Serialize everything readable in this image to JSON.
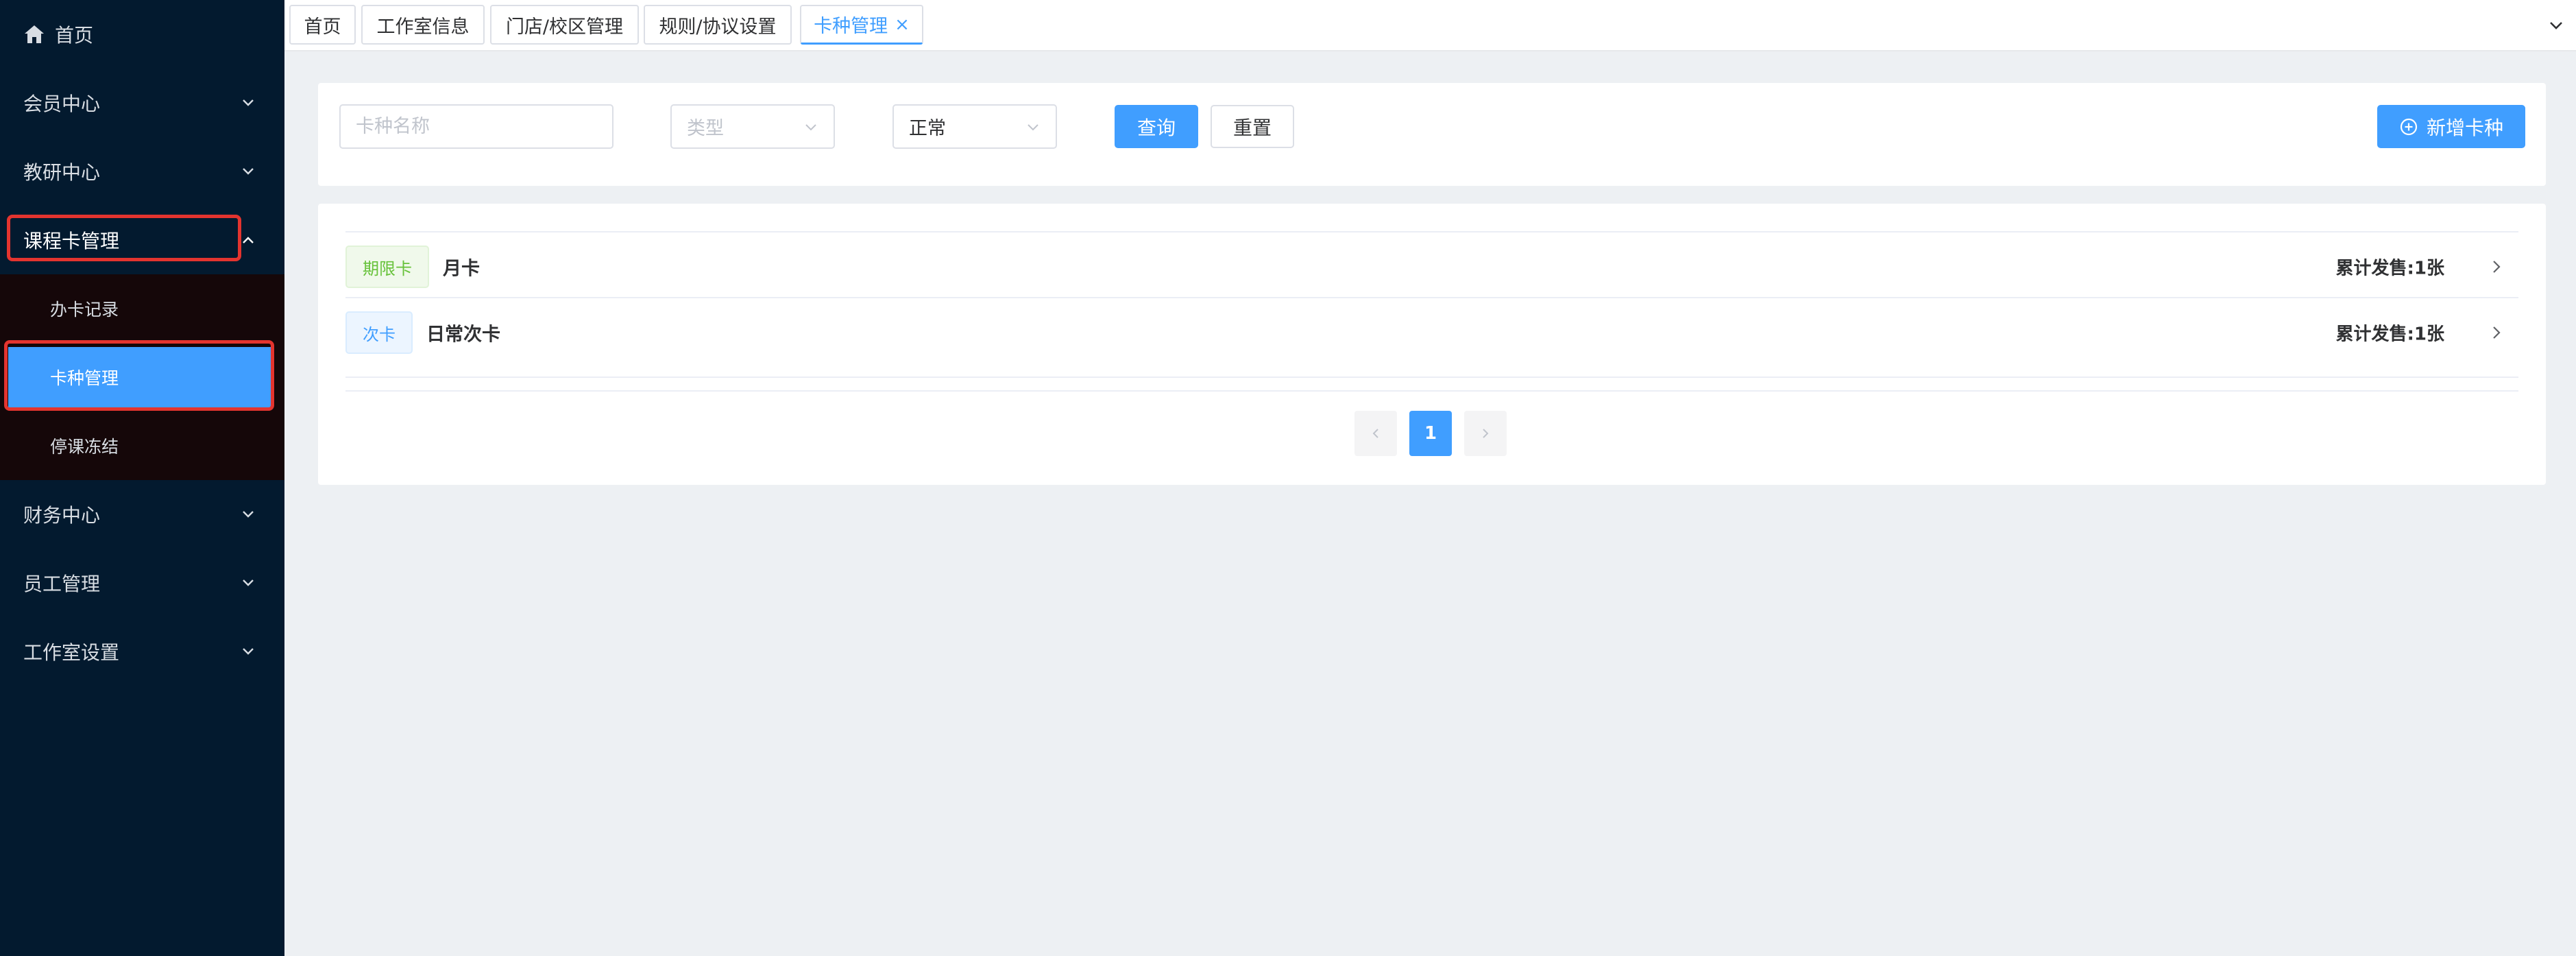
{
  "sidebar": {
    "home": {
      "label": "首页",
      "icon": "home-icon"
    },
    "groups": [
      {
        "label": "会员中心"
      },
      {
        "label": "教研中心"
      },
      {
        "label": "课程卡管理"
      },
      {
        "label": "财务中心"
      },
      {
        "label": "员工管理"
      },
      {
        "label": "工作室设置"
      }
    ],
    "submenu": [
      {
        "label": "办卡记录"
      },
      {
        "label": "卡种管理"
      },
      {
        "label": "停课冻结"
      }
    ],
    "active_item": "卡种管理",
    "colors": {
      "background": "#031a2f",
      "submenu_bg": "#150709",
      "active": "#409eff",
      "highlight_box": "#e3342f"
    }
  },
  "tabs": [
    {
      "label": "首页"
    },
    {
      "label": "工作室信息"
    },
    {
      "label": "门店/校区管理"
    },
    {
      "label": "规则/协议设置"
    },
    {
      "label": "卡种管理",
      "close": "×"
    }
  ],
  "filters": {
    "name_placeholder": "卡种名称",
    "type_placeholder": "类型",
    "status_value": "正常",
    "query_label": "查询",
    "reset_label": "重置",
    "add_label": "新增卡种"
  },
  "cards": [
    {
      "tag": "期限卡",
      "name": "月卡",
      "sales": "累计发售:1张"
    },
    {
      "tag": "次卡",
      "name": "日常次卡",
      "sales": "累计发售:1张"
    }
  ],
  "pagination": {
    "current": "1"
  },
  "colors": {
    "primary": "#409eff",
    "tag_green": "#67c23a",
    "page_bg": "#edf0f3"
  }
}
